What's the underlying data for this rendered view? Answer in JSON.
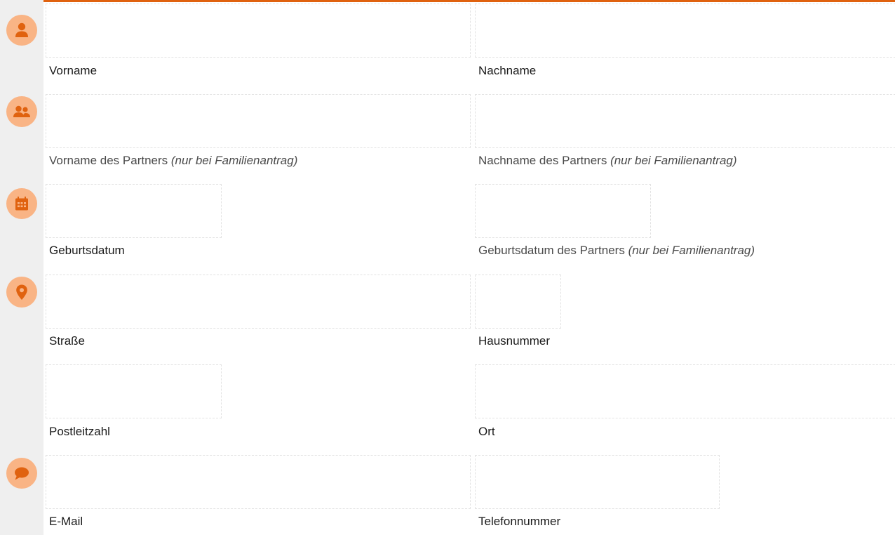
{
  "accent_color": "#e0620f",
  "badge_color": "#f9b485",
  "icons": {
    "row1": "person-icon",
    "row2": "people-icon",
    "row3": "calendar-icon",
    "row4": "location-pin-icon",
    "row6": "speech-bubble-icon"
  },
  "form": {
    "first_name": {
      "label": "Vorname",
      "value": ""
    },
    "last_name": {
      "label": "Nachname",
      "value": ""
    },
    "partner_first_name": {
      "label": "Vorname des Partners",
      "hint": "(nur bei Familienantrag)",
      "value": ""
    },
    "partner_last_name": {
      "label": "Nachname des Partners",
      "hint": "(nur bei Familienantrag)",
      "value": ""
    },
    "birth_date": {
      "label": "Geburtsdatum",
      "value": ""
    },
    "partner_birth_date": {
      "label": "Geburtsdatum des Partners",
      "hint": "(nur bei Familienantrag)",
      "value": ""
    },
    "street": {
      "label": "Straße",
      "value": ""
    },
    "house_number": {
      "label": "Hausnummer",
      "value": ""
    },
    "postal_code": {
      "label": "Postleitzahl",
      "value": ""
    },
    "city": {
      "label": "Ort",
      "value": ""
    },
    "email": {
      "label": "E-Mail",
      "value": ""
    },
    "phone": {
      "label": "Telefonnummer",
      "value": ""
    }
  }
}
